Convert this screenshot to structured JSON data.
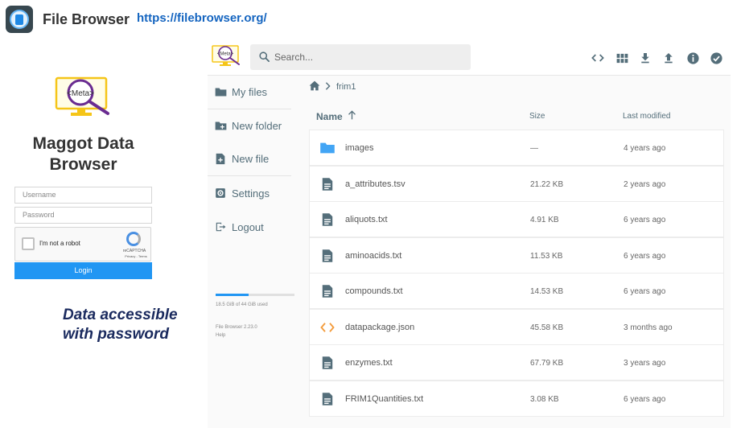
{
  "banner": {
    "title": "File Browser",
    "url": "https://filebrowser.org/"
  },
  "login": {
    "logo_text": "<Meta>",
    "title": "Maggot Data Browser",
    "username_placeholder": "Username",
    "password_placeholder": "Password",
    "captcha_label": "I'm not a robot",
    "captcha_brand": "reCAPTCHA",
    "captcha_terms": "Privacy - Terms",
    "login_button": "Login",
    "caption_line1": "Data accessible",
    "caption_line2": "with password"
  },
  "app": {
    "logo_text": "<Meta>",
    "search_placeholder": "Search...",
    "header_icons": [
      "code-icon",
      "grid-view-icon",
      "download-icon",
      "upload-icon",
      "info-icon",
      "check-circle-icon"
    ],
    "sidebar": {
      "items": [
        {
          "label": "My files",
          "icon": "folder-icon"
        },
        {
          "label": "New folder",
          "icon": "new-folder-icon"
        },
        {
          "label": "New file",
          "icon": "new-file-icon"
        },
        {
          "label": "Settings",
          "icon": "settings-icon"
        },
        {
          "label": "Logout",
          "icon": "logout-icon"
        }
      ],
      "storage_used_fraction": 0.42,
      "storage_text": "18.5 GiB of 44 GiB used",
      "version_text": "File Browser 2.23.0",
      "help_text": "Help"
    },
    "breadcrumb": {
      "home_icon": "home-icon",
      "folder": "frim1"
    },
    "columns": {
      "name": "Name",
      "size": "Size",
      "modified": "Last modified"
    },
    "files": [
      {
        "name": "images",
        "size": "—",
        "modified": "4 years ago",
        "type": "folder"
      },
      {
        "name": "a_attributes.tsv",
        "size": "21.22 KB",
        "modified": "2 years ago",
        "type": "file"
      },
      {
        "name": "aliquots.txt",
        "size": "4.91 KB",
        "modified": "6 years ago",
        "type": "file"
      },
      {
        "name": "aminoacids.txt",
        "size": "11.53 KB",
        "modified": "6 years ago",
        "type": "file"
      },
      {
        "name": "compounds.txt",
        "size": "14.53 KB",
        "modified": "6 years ago",
        "type": "file"
      },
      {
        "name": "datapackage.json",
        "size": "45.58 KB",
        "modified": "3 months ago",
        "type": "code"
      },
      {
        "name": "enzymes.txt",
        "size": "67.79 KB",
        "modified": "3 years ago",
        "type": "file"
      },
      {
        "name": "FRIM1Quantities.txt",
        "size": "3.08 KB",
        "modified": "6 years ago",
        "type": "file"
      }
    ]
  },
  "colors": {
    "accent": "#2196f3",
    "caption": "#1a2a5e",
    "url": "#1565c0",
    "folder": "#42a5f5",
    "code_icon": "#f39c3d",
    "icon_gray": "#546e7a"
  }
}
